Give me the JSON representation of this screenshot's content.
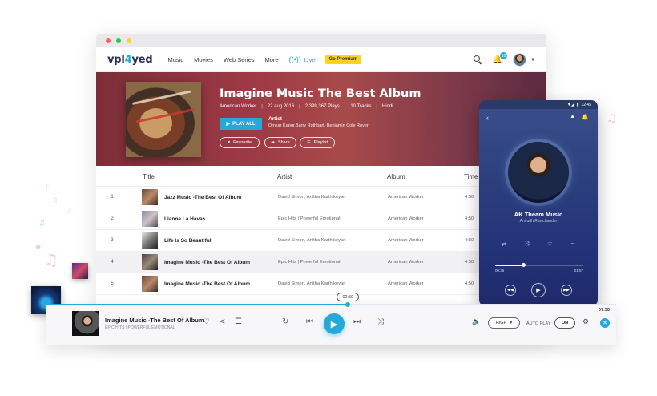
{
  "nav": {
    "logo_a": "vpl",
    "logo_b": "4",
    "logo_c": "yed",
    "links": [
      "Music",
      "Movies",
      "Web Series",
      "More"
    ],
    "live": "Live",
    "premium": "Go Premium",
    "notif_count": "18"
  },
  "album": {
    "title": "Imagine Music The Best Album",
    "meta": [
      "American Worker",
      "22 aug 2016",
      "2,399,367 Plays",
      "10 Tracks",
      "Hindi"
    ],
    "play_all": "PLAY ALL",
    "artist_label": "Artist",
    "artist_names": "Omkar Kapur,Barry Rothbart, Benjamin Cole Royer",
    "actions": [
      "Favourite",
      "Share",
      "Playlist"
    ]
  },
  "table": {
    "headers": [
      "Title",
      "Artist",
      "Album",
      "Time"
    ],
    "rows": [
      {
        "num": "1",
        "title": "Jazz Music -The Best Of Album",
        "artist": "David Simon, Anitha Karthikeyan",
        "album": "American Worker",
        "time": "4:50"
      },
      {
        "num": "2",
        "title": "Lianne La Havas",
        "artist": "Epic Hits  |  Powerful Emotional",
        "album": "American Worker",
        "time": "4:50"
      },
      {
        "num": "3",
        "title": "Life Is So Beautiful",
        "artist": "David Simon, Anitha Karthikeyan",
        "album": "American Worker",
        "time": "4:50"
      },
      {
        "num": "4",
        "title": "Imagine Music -The Best Of Album",
        "artist": "Epic Hits  |  Powerful Emotional",
        "album": "American Worker",
        "time": "4:50"
      },
      {
        "num": "5",
        "title": "Imagine Music -The Best Of Album",
        "artist": "David Simon, Anitha Karthikeyan",
        "album": "American Worker",
        "time": "4:50"
      }
    ]
  },
  "phone": {
    "clock": "12:45",
    "song": "AK Theam Music",
    "artist": "Anirudh Ravichander",
    "elapsed": "00:35",
    "total": "01:57",
    "progress": 0.32
  },
  "player": {
    "title": "Imagine Music -The Best Of Album",
    "subtitle": "EPIC HITS  |  POWERFUL EMOTIONAL",
    "current_time": "02:50",
    "total_time": "07:50",
    "progress": 0.53,
    "quality": "HIGH",
    "autoplay_label": "AUTO PLAY",
    "autoplay_state": "ON"
  },
  "colors": {
    "accent": "#26a8d8",
    "premium": "#ffd21f"
  }
}
